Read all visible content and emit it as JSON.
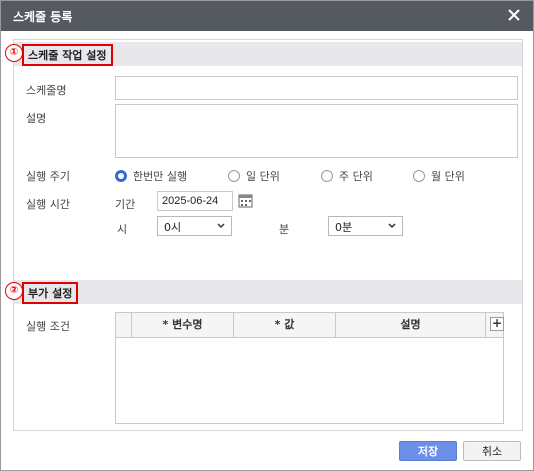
{
  "dialog": {
    "title": "스케줄 등록"
  },
  "section1": {
    "number": "①",
    "label": "스케줄 작업 설정"
  },
  "section2": {
    "number": "②",
    "label": "부가 설정"
  },
  "form": {
    "schedule_name_label": "스케줄명",
    "schedule_name_value": "",
    "description_label": "설명",
    "description_value": "",
    "run_cycle_label": "실행 주기",
    "run_cycle_options": [
      {
        "label": "한번만 실행",
        "checked": true
      },
      {
        "label": "일 단위",
        "checked": false
      },
      {
        "label": "주 단위",
        "checked": false
      },
      {
        "label": "월 단위",
        "checked": false
      }
    ],
    "run_time_label": "실행 시간",
    "period_label": "기간",
    "period_value": "2025-06-24",
    "hour_label": "시",
    "hour_value": "0시",
    "minute_label": "분",
    "minute_value": "0분",
    "run_condition_label": "실행 조건"
  },
  "grid": {
    "columns": [
      "* 변수명",
      "* 값",
      "설명"
    ],
    "add_label": "+"
  },
  "footer": {
    "save_label": "저장",
    "cancel_label": "취소"
  },
  "colors": {
    "title_bar": "#555a60",
    "accent": "#3b67d6",
    "highlight": "#e00000",
    "primary_button": "#6c8fe8"
  }
}
